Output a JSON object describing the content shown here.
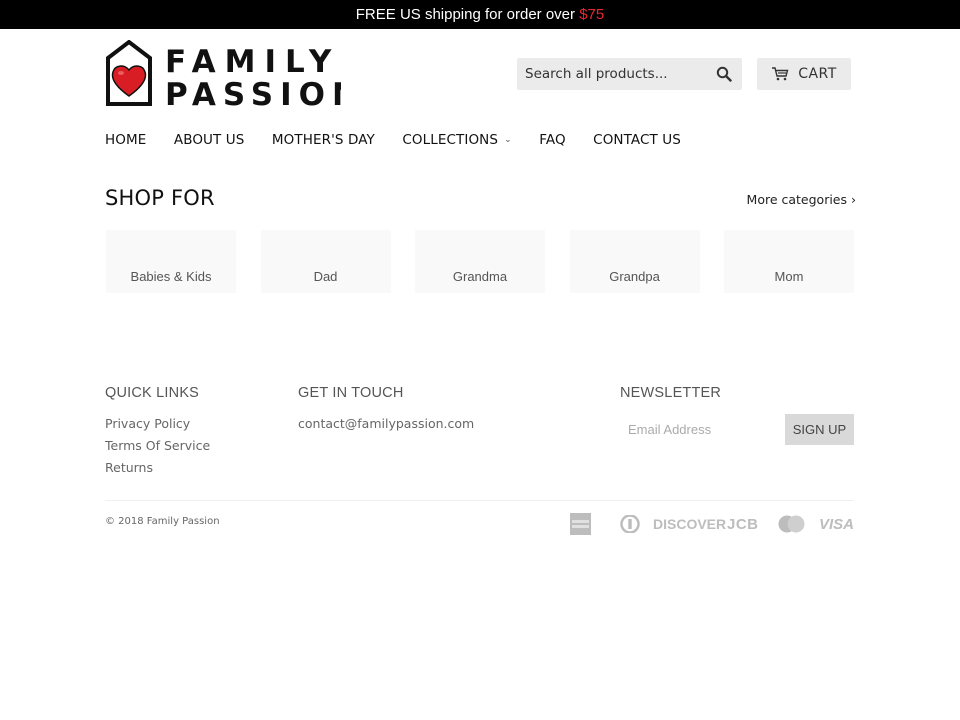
{
  "announcement": {
    "text": "FREE US shipping for order over ",
    "price": "$75",
    "price_color": "#e8262d"
  },
  "brand": {
    "name": "Family Passion",
    "logo_line1": "FAMILY",
    "logo_line2": "PASSION",
    "heart_color": "#d81e24"
  },
  "header": {
    "search_placeholder": "Search all products...",
    "search_icon": "search-icon",
    "cart_label": "CART",
    "cart_icon": "cart-icon"
  },
  "nav": {
    "items": [
      {
        "label": "HOME"
      },
      {
        "label": "ABOUT US"
      },
      {
        "label": "MOTHER'S DAY"
      },
      {
        "label": "COLLECTIONS",
        "dropdown": "›"
      },
      {
        "label": "FAQ"
      },
      {
        "label": "CONTACT US"
      }
    ]
  },
  "shop_for": {
    "title": "SHOP FOR",
    "more_label": "More categories ›",
    "categories": [
      {
        "label": "Babies & Kids"
      },
      {
        "label": "Dad"
      },
      {
        "label": "Grandma"
      },
      {
        "label": "Grandpa"
      },
      {
        "label": "Mom"
      }
    ]
  },
  "footer": {
    "quick_links": {
      "title": "QUICK LINKS",
      "links": [
        {
          "label": "Privacy Policy"
        },
        {
          "label": "Terms Of Service"
        },
        {
          "label": "Returns"
        }
      ]
    },
    "get_in_touch": {
      "title": "GET IN TOUCH",
      "email": "contact@familypassion.com"
    },
    "newsletter": {
      "title": "NEWSLETTER",
      "placeholder": "Email Address",
      "button_label": "SIGN UP"
    },
    "copyright": "© 2018 Family Passion",
    "payment_methods": [
      {
        "name": "American Express",
        "icon": "amex-icon"
      },
      {
        "name": "Diners Club",
        "icon": "diners-icon"
      },
      {
        "name": "Discover",
        "icon": "discover-icon",
        "text": "DISCOVER"
      },
      {
        "name": "JCB",
        "icon": "jcb-icon",
        "text": "JCB"
      },
      {
        "name": "Mastercard",
        "icon": "mastercard-icon"
      },
      {
        "name": "Visa",
        "icon": "visa-icon",
        "text": "VISA"
      }
    ]
  }
}
